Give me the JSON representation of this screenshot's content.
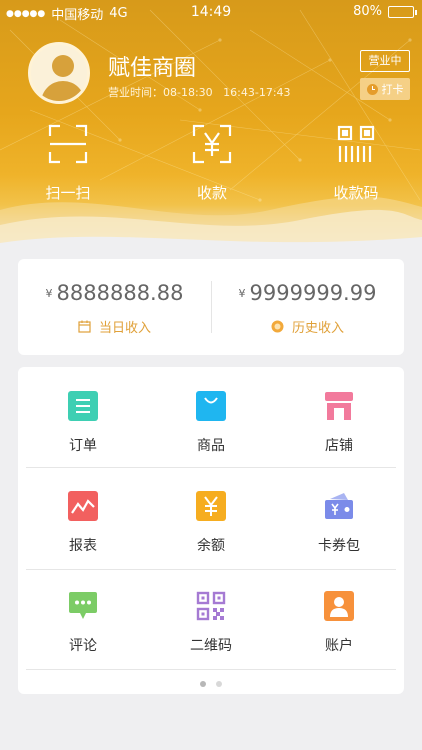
{
  "status_bar": {
    "signal_dots": "●●●●●",
    "carrier": "中国移动",
    "network": "4G",
    "time": "14:49",
    "battery": "80%",
    "battery_level": 0.8
  },
  "profile": {
    "shop_name": "赋佳商圈",
    "hours_label": "营业时间：",
    "hours": "08-18:30   16:43-17:43",
    "status_badge": "营业中",
    "clock_in_label": "打卡"
  },
  "quick_actions": [
    {
      "icon": "scan-icon",
      "label": "扫一扫"
    },
    {
      "icon": "collect-money-icon",
      "label": "收款"
    },
    {
      "icon": "payment-code-icon",
      "label": "收款码"
    }
  ],
  "income": {
    "today": {
      "currency": "¥",
      "amount": "8888888.88",
      "label": "当日收入",
      "icon": "calendar-icon"
    },
    "history": {
      "currency": "¥",
      "amount": "9999999.99",
      "label": "历史收入",
      "icon": "coin-icon"
    }
  },
  "menu": [
    {
      "icon": "orders-icon",
      "label": "订单",
      "color": "#3ecfb3"
    },
    {
      "icon": "products-icon",
      "label": "商品",
      "color": "#1fb6f0"
    },
    {
      "icon": "store-icon",
      "label": "店铺",
      "color": "#f27a9c"
    },
    {
      "icon": "report-icon",
      "label": "报表",
      "color": "#f2605f"
    },
    {
      "icon": "balance-icon",
      "label": "余额",
      "color": "#f6ad20"
    },
    {
      "icon": "coupon-wallet-icon",
      "label": "卡券包",
      "color": "#7b8be9"
    },
    {
      "icon": "comments-icon",
      "label": "评论",
      "color": "#7ccc66"
    },
    {
      "icon": "qr-code-icon",
      "label": "二维码",
      "color": "#a57ad3"
    },
    {
      "icon": "account-icon",
      "label": "账户",
      "color": "#f7913b"
    }
  ],
  "pager": {
    "pages": 2,
    "current": 1
  }
}
